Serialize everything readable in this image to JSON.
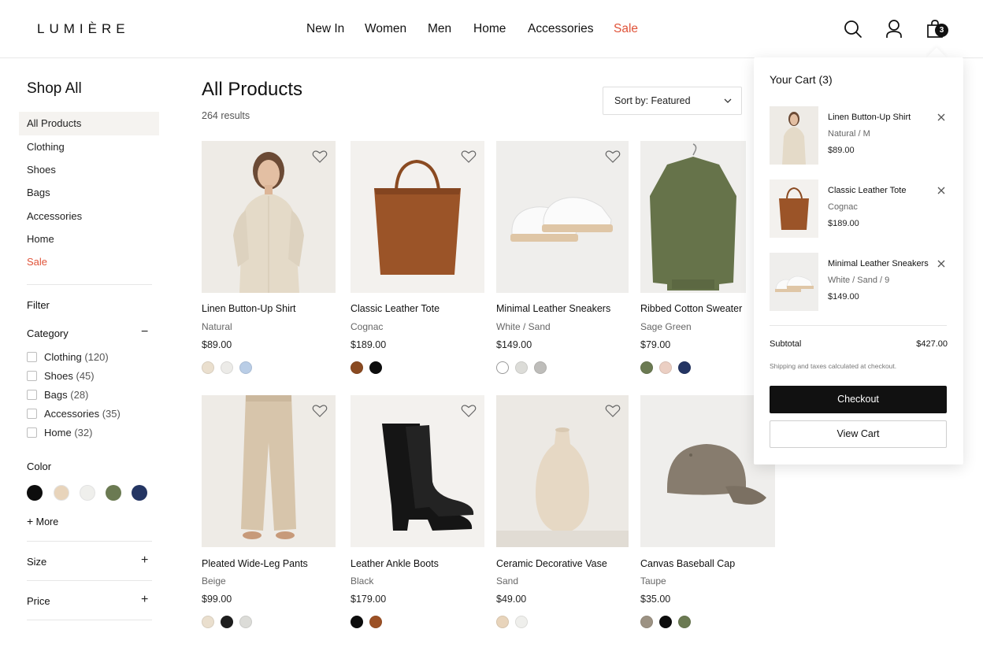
{
  "brand": "LUMIÈRE",
  "nav": {
    "new_in": "New In",
    "women": "Women",
    "men": "Men",
    "home": "Home",
    "accessories": "Accessories",
    "sale": "Sale"
  },
  "header_icons": {
    "search": "search-icon",
    "account": "user-icon",
    "bag": "shopping-bag-icon",
    "bag_count": "3"
  },
  "sidebar": {
    "title": "Shop All",
    "categories": [
      {
        "label": "All Products"
      },
      {
        "label": "Clothing"
      },
      {
        "label": "Shoes"
      },
      {
        "label": "Bags"
      },
      {
        "label": "Accessories"
      },
      {
        "label": "Home"
      },
      {
        "label": "Sale"
      }
    ],
    "filter_label": "Filter",
    "category_label": "Category",
    "category_options": [
      {
        "label": "Clothing",
        "count": "(120)"
      },
      {
        "label": "Shoes",
        "count": "(45)"
      },
      {
        "label": "Bags",
        "count": "(28)"
      },
      {
        "label": "Accessories",
        "count": "(35)"
      },
      {
        "label": "Home",
        "count": "(32)"
      }
    ],
    "color_label": "Color",
    "color_swatches": [
      "#0d0d0d",
      "#e8d4bb",
      "#efefec",
      "#6b7a52",
      "#243563"
    ],
    "more_label": "More",
    "size_label": "Size",
    "price_label": "Price"
  },
  "main": {
    "title": "All Products",
    "results": "264 results",
    "sort_label": "Sort by: Featured"
  },
  "products": [
    {
      "name": "Linen Button-Up Shirt",
      "color": "Natural",
      "price": "$89.00",
      "swatches": [
        "#eadfce",
        "#ecebe8",
        "#b9cde6"
      ]
    },
    {
      "name": "Classic Leather Tote",
      "color": "Cognac",
      "price": "$189.00",
      "swatches": [
        "#8a4a21",
        "#0d0d0d"
      ]
    },
    {
      "name": "Minimal Leather Sneakers",
      "color": "White / Sand",
      "price": "$149.00",
      "swatches": [
        "#ffffff",
        "#dcdcd8",
        "#bebdba"
      ]
    },
    {
      "name": "Ribbed Cotton Sweater",
      "color": "Sage Green",
      "price": "$79.00",
      "swatches": [
        "#6b7a52",
        "#ebcfc3",
        "#243563"
      ]
    },
    {
      "name": "Pleated Wide-Leg Pants",
      "color": "Beige",
      "price": "$99.00",
      "swatches": [
        "#eadfce",
        "#1e1e1e",
        "#dcdcd8"
      ]
    },
    {
      "name": "Leather Ankle Boots",
      "color": "Black",
      "price": "$179.00",
      "swatches": [
        "#0d0d0d",
        "#9c5126"
      ]
    },
    {
      "name": "Ceramic Decorative Vase",
      "color": "Sand",
      "price": "$49.00",
      "swatches": [
        "#e8d4bb",
        "#efefec"
      ]
    },
    {
      "name": "Canvas Baseball Cap",
      "color": "Taupe",
      "price": "$35.00",
      "swatches": [
        "#9c9283",
        "#0d0d0d",
        "#6b7a52"
      ]
    }
  ],
  "cart": {
    "title": "Your Cart (3)",
    "items": [
      {
        "name": "Linen Button-Up Shirt",
        "variant": "Natural / M",
        "price": "$89.00"
      },
      {
        "name": "Classic Leather Tote",
        "variant": "Cognac",
        "price": "$189.00"
      },
      {
        "name": "Minimal Leather Sneakers",
        "variant": "White / Sand / 9",
        "price": "$149.00"
      }
    ],
    "subtotal_label": "Subtotal",
    "subtotal_value": "$427.00",
    "shipping_note": "Shipping and taxes calculated at checkout.",
    "checkout_label": "Checkout",
    "view_cart_label": "View Cart"
  }
}
